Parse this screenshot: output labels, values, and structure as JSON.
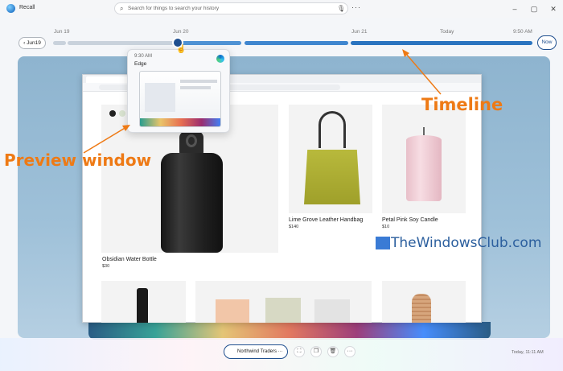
{
  "window": {
    "title": "Recall"
  },
  "search": {
    "placeholder": "Search for things to search your history"
  },
  "timeline": {
    "labels": [
      "Jun 19",
      "Jun 20",
      "Jun 21",
      "Today",
      "9:50 AM"
    ],
    "date_button": "Jun19",
    "now_button": "Now"
  },
  "preview": {
    "time": "9:30 AM",
    "app": "Edge"
  },
  "products": [
    {
      "name": "Obsidian Water Bottle",
      "price": "$30"
    },
    {
      "name": "Lime Grove Leather Handbag",
      "price": "$140"
    },
    {
      "name": "Petal Pink Soy Candle",
      "price": "$10"
    }
  ],
  "annotations": {
    "timeline": "Timeline",
    "preview": "Preview window"
  },
  "watermark": "TheWindowsClub.com",
  "taskbar": {
    "app": "Northwind Traders",
    "timestamp": "Today, 11:11 AM"
  },
  "colors": {
    "accent": "#1f4f8f",
    "annotation": "#ee7a15"
  }
}
